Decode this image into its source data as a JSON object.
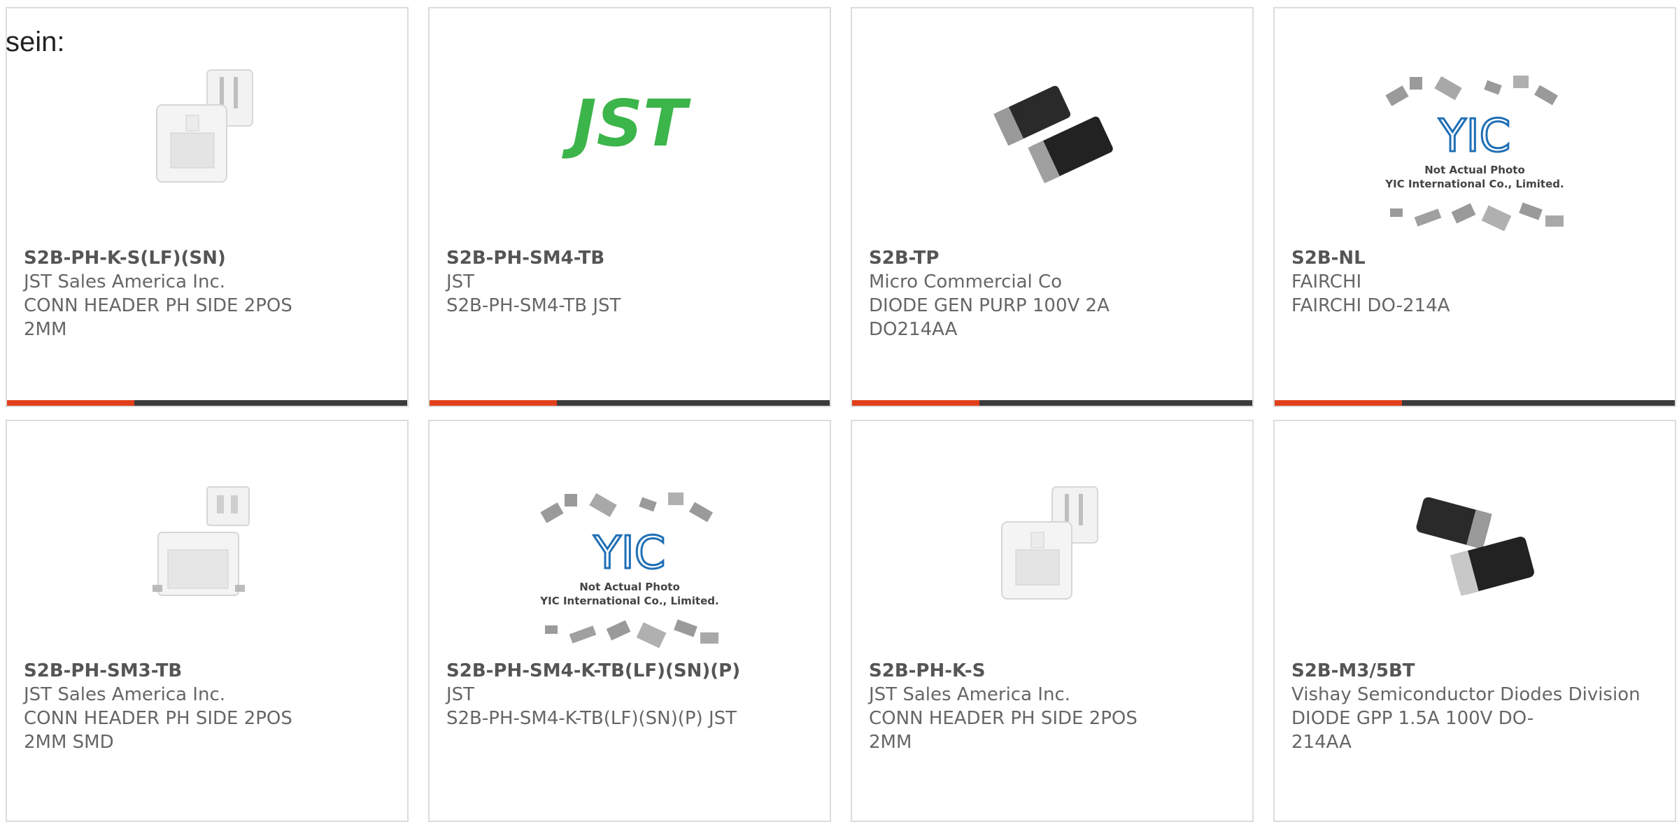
{
  "intro_text": "sein:",
  "colors": {
    "accent": "#e0401a",
    "bar": "#3b3b3b",
    "border": "#dcdcdc",
    "jst_green": "#3cb54a",
    "yic_blue": "#1f6fb5"
  },
  "products": [
    {
      "part": "S2B-PH-K-S(LF)(SN)",
      "manufacturer": "JST Sales America Inc.",
      "description": "CONN HEADER PH SIDE 2POS 2MM",
      "image": "connector-header-icon"
    },
    {
      "part": "S2B-PH-SM4-TB",
      "manufacturer": "JST",
      "description": "S2B-PH-SM4-TB JST",
      "image": "jst-logo"
    },
    {
      "part": "S2B-TP",
      "manufacturer": "Micro Commercial Co",
      "description": "DIODE GEN PURP 100V 2A DO214AA",
      "image": "diode-smd-icon"
    },
    {
      "part": "S2B-NL",
      "manufacturer": "FAIRCHI",
      "description": "FAIRCHI DO-214A",
      "image": "yic-placeholder",
      "placeholder": {
        "logo": "YIC",
        "line1": "Not Actual Photo",
        "line2": "YIC International Co., Limited."
      }
    },
    {
      "part": "S2B-PH-SM3-TB",
      "manufacturer": "JST Sales America Inc.",
      "description": "CONN HEADER PH SIDE 2POS 2MM SMD",
      "image": "connector-smd-icon"
    },
    {
      "part": "S2B-PH-SM4-K-TB(LF)(SN)(P)",
      "manufacturer": "JST",
      "description": "S2B-PH-SM4-K-TB(LF)(SN)(P) JST",
      "image": "yic-placeholder",
      "placeholder": {
        "logo": "YIC",
        "line1": "Not Actual Photo",
        "line2": "YIC International Co., Limited."
      }
    },
    {
      "part": "S2B-PH-K-S",
      "manufacturer": "JST Sales America Inc.",
      "description": "CONN HEADER PH SIDE 2POS 2MM",
      "image": "connector-header-icon"
    },
    {
      "part": "S2B-M3/5BT",
      "manufacturer": "Vishay Semiconductor Diodes Division",
      "description": "DIODE GPP 1.5A 100V DO-214AA",
      "image": "diode-smd-icon"
    }
  ]
}
